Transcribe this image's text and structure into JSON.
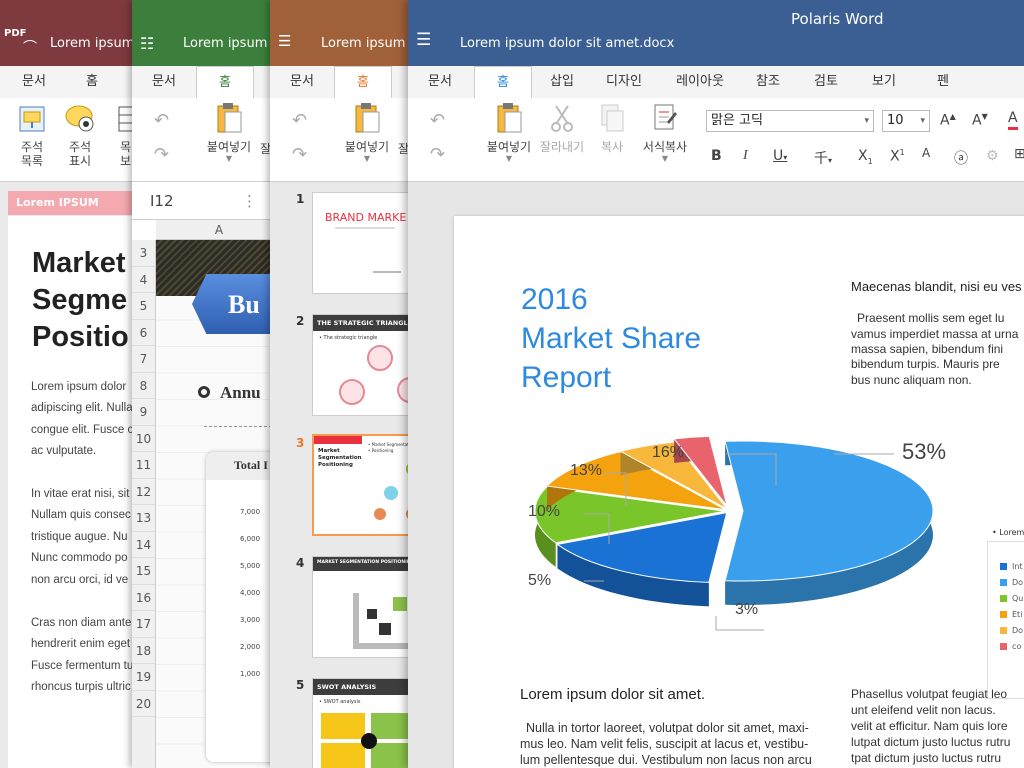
{
  "pdf_window": {
    "badge": "PDF",
    "title": "Lorem ipsum",
    "tabs": [
      "문서",
      "홈"
    ],
    "ribbon": [
      {
        "label": "주석\n목록",
        "icon": "comment-list-icon"
      },
      {
        "label": "주석\n표시",
        "icon": "comment-view-icon"
      },
      {
        "label": "목\n보",
        "icon": "table-icon"
      }
    ],
    "sidebar_head": "Lorem IPSUM",
    "heading": "Market\nSegme\nPositio",
    "para1": [
      "Lorem ipsum dolor",
      "adipiscing elit. Nulla",
      "congue elit. Fusce c",
      "ac vulputate."
    ],
    "para2": [
      "In vitae erat nisi, sit",
      "Nullam quis consec",
      "tristique augue. Nu",
      "Nunc commodo po",
      "non arcu orci, id ve"
    ],
    "para3": [
      "Cras non diam ante",
      "hendrerit enim eget",
      "Fusce fermentum tu",
      "rhoncus turpis ultric"
    ]
  },
  "sheet_window": {
    "title": "Lorem ipsum d",
    "tabs": [
      "문서",
      "홈"
    ],
    "paste_label": "붙여넣기",
    "paste_cut": "잘",
    "cell_ref": "I12",
    "col_label": "A",
    "rows": [
      "3",
      "4",
      "5",
      "6",
      "7",
      "8",
      "9",
      "10",
      "11",
      "12",
      "13",
      "14",
      "15",
      "16",
      "17",
      "18",
      "19",
      "20"
    ],
    "banner": "Bu",
    "section": "Annu",
    "chart_title": "Total I",
    "y_ticks": [
      "7,000",
      "6,000",
      "5,000",
      "4,000",
      "3,000",
      "2,000",
      "1,000"
    ]
  },
  "ppt_window": {
    "title": "Lorem ipsum d",
    "tabs": [
      "문서",
      "홈"
    ],
    "paste_label": "붙여넣기",
    "paste_cut": "잘",
    "slides": [
      {
        "num": "1",
        "title": "BRAND MARKE"
      },
      {
        "num": "2",
        "title": "THE STRATEGIC TRIANGLE",
        "bullet": "• The strategic triangle"
      },
      {
        "num": "3",
        "title": "Market\nSegmentation\nPositioning",
        "side": "• Market Segmentation\n• Positioning"
      },
      {
        "num": "4",
        "title": "MARKET SEGMENTATION POSITIONIN"
      },
      {
        "num": "5",
        "title": "SWOT ANALYSIS",
        "sub": "• SWOT analysis"
      }
    ]
  },
  "word_window": {
    "app_name": "Polaris Word",
    "doc_title": "Lorem ipsum dolor sit amet.docx",
    "tabs": [
      "문서",
      "홈",
      "삽입",
      "디자인",
      "레이아웃",
      "참조",
      "검토",
      "보기",
      "펜"
    ],
    "active_tab": "홈",
    "ribbon": {
      "paste": "붙여넣기",
      "cut": "잘라내기",
      "copy": "복사",
      "format_painter": "서식복사",
      "font": "맑은 고딕",
      "size": "10"
    },
    "report_title": "2016\nMarket Share\nReport",
    "right_head": "Maecenas blandit, nisi eu ves",
    "right_para": [
      "Praesent mollis sem eget lu",
      "vamus imperdiet massa at urna",
      "massa sapien, bibendum fini",
      "bibendum turpis. Mauris pre",
      "bus nunc aliquam non."
    ],
    "bottom_head": "Lorem ipsum dolor sit amet.",
    "bottom_para": [
      "Nulla in tortor laoreet, volutpat dolor sit amet, maxi-",
      "mus leo. Nam velit felis, suscipit at lacus et, vestibu-",
      "lum pellentesque dui. Vestibulum non lacus non arcu"
    ],
    "bottom_right_para": [
      "Phasellus volutpat feugiat leo",
      "unt eleifend velit non lacus.",
      "velit at efficitur. Nam quis lore",
      "lutpat dictum justo luctus rutru",
      "tpat dictum justo luctus rutru"
    ],
    "legend_title": "• Lorem i",
    "legend_items": [
      "Int",
      "Do",
      "Qu",
      "Eti",
      "Do",
      "co"
    ]
  },
  "chart_data": {
    "type": "pie",
    "categories": [
      "Int",
      "Do",
      "Qu",
      "Eti",
      "Do",
      "co"
    ],
    "values": [
      53,
      16,
      13,
      10,
      5,
      3
    ],
    "labels": [
      "53%",
      "16%",
      "13%",
      "10%",
      "5%",
      "3%"
    ],
    "colors": [
      "#3aa0ee",
      "#1a72d4",
      "#7ac62a",
      "#f5a20f",
      "#f7b73a",
      "#e8636c"
    ],
    "legend_position": "right"
  },
  "colors": {
    "pdf_title": "#7e3a3e",
    "sheet_title": "#3c7f3c",
    "ppt_title": "#a0603a",
    "word_title": "#3c5f93",
    "accent_blue": "#2d8ae0"
  }
}
